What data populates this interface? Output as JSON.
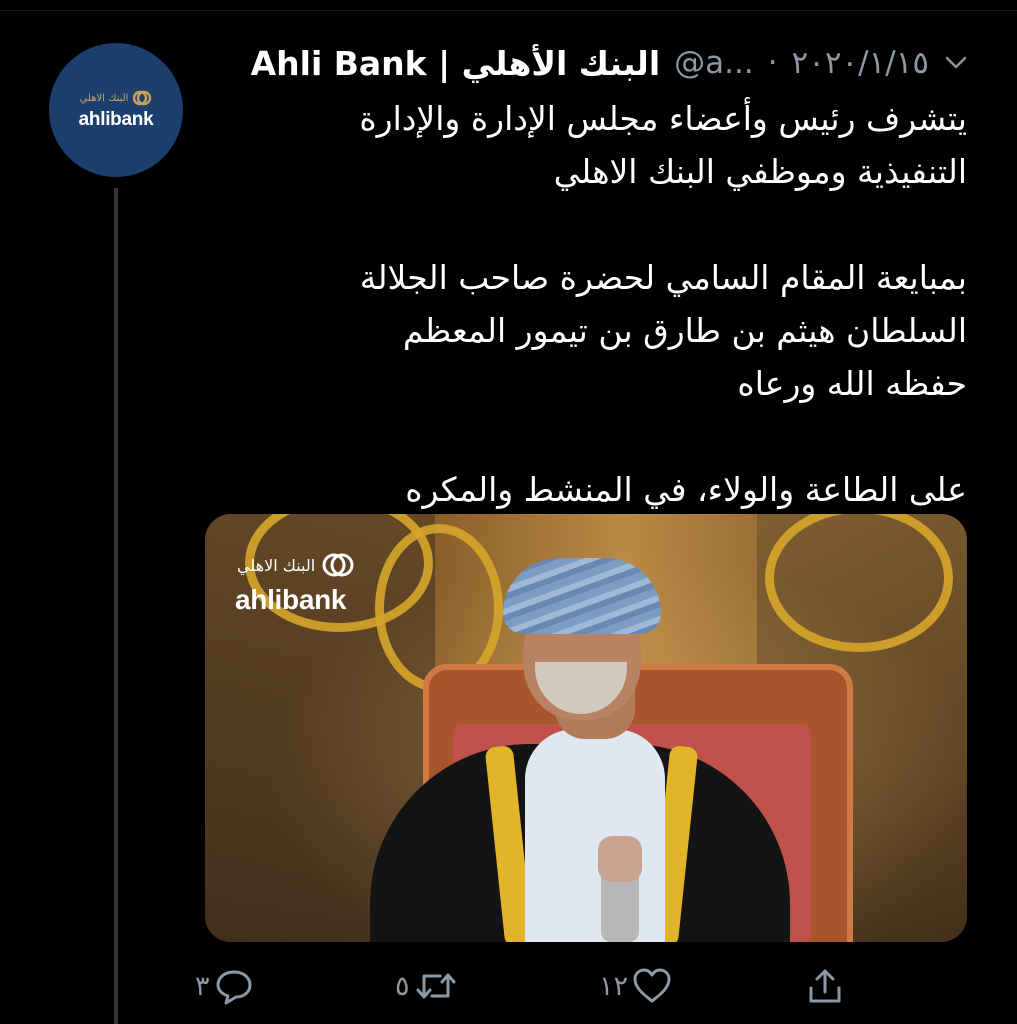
{
  "tweet": {
    "display_name": "Ahli Bank | البنك الأهلي",
    "handle": "@a...",
    "separator": "·",
    "date": "٢٠٢٠/١/١٥",
    "text_lines": [
      "يتشرف رئيس وأعضاء مجلس الإدارة والإدارة",
      "التنفيذية وموظفي البنك الاهلي",
      "بمبايعة المقام السامي لحضرة صاحب الجلالة",
      "السلطان هيثم بن طارق بن تيمور المعظم",
      "حفظه الله ورعاه",
      "على الطاعة والولاء، في المنشط والمكره"
    ]
  },
  "avatar": {
    "arabic": "البنك الاهلي",
    "english": "ahlibank"
  },
  "media": {
    "logo_arabic": "البنك الاهلي",
    "logo_english": "ahlibank"
  },
  "actions": {
    "reply_count": "٣",
    "retweet_count": "٥",
    "like_count": "١٢"
  },
  "colors": {
    "background": "#000000",
    "secondary_text": "#8b98a5",
    "avatar_bg": "#1d3f6e",
    "brand_gold": "#c9a25b",
    "thread_line": "#333639"
  },
  "icons": [
    "chevron-down-icon",
    "ahlibank-logo-icon",
    "reply-icon",
    "retweet-icon",
    "like-icon",
    "share-icon"
  ]
}
